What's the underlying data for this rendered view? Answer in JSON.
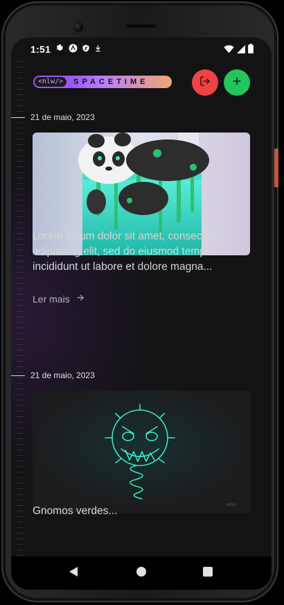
{
  "status_bar": {
    "time": "1:51",
    "left_icons": [
      "gear-icon",
      "android-icon",
      "shield-icon",
      "download-icon"
    ],
    "right_icons": [
      "wifi-icon",
      "signal-icon",
      "battery-icon"
    ]
  },
  "header": {
    "logo_tag": "<nlw/>",
    "logo_word": "SPACETIME",
    "logout_button": "logout-icon",
    "add_button": "plus-icon",
    "colors": {
      "logout": "#ef4444",
      "add": "#22c55e"
    }
  },
  "memories": [
    {
      "date": "21  de maio, 2023",
      "image": "panda-dripping-cake-image",
      "excerpt": "Lorem ipsum dolor sit amet, consectetur adipiscing elit, sed do eiusmod tempor incididunt ut labore et dolore magna...",
      "read_more": "Ler mais"
    },
    {
      "date": "21  de maio, 2023",
      "image": "neon-gnome-image",
      "excerpt": "Gnomos verdes..."
    }
  ],
  "nav_bar": {
    "buttons": [
      "back-icon",
      "home-icon",
      "recents-icon"
    ]
  }
}
